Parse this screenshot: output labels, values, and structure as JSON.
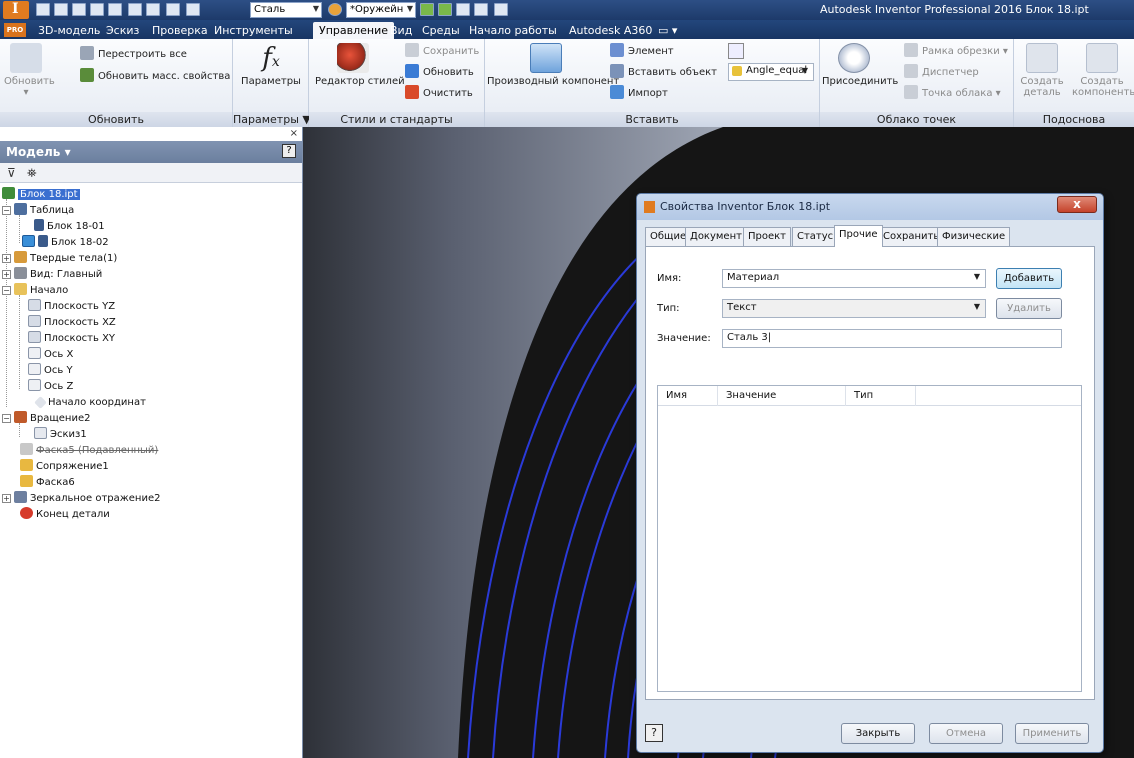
{
  "window": {
    "app_title": "Autodesk Inventor Professional 2016  Блок 18.ipt",
    "qat": {
      "material_combo": "Сталь",
      "appearance_combo": "*Оружейн"
    }
  },
  "ribbon_tabs": [
    "3D-модель",
    "Эскиз",
    "Проверка",
    "Инструменты",
    "Управление",
    "Вид",
    "Среды",
    "Начало работы",
    "Autodesk A360"
  ],
  "active_tab": "Управление",
  "pro_badge": "PRO",
  "ribbon": {
    "update": {
      "title": "Обновить",
      "big_button": "Обновить",
      "rebuild_all": "Перестроить все",
      "update_mass": "Обновить масс. свойства"
    },
    "parameters": {
      "title": "Параметры ▼",
      "button": "Параметры"
    },
    "styles": {
      "title": "Стили и стандарты",
      "editor": "Редактор стилей",
      "save": "Сохранить",
      "update": "Обновить",
      "clear": "Очистить"
    },
    "insert": {
      "title": "Вставить",
      "derived": "Производный компонент",
      "element": "Элемент",
      "insert_object": "Вставить объект",
      "import": "Импорт",
      "ifeature_combo": "Angle_equal"
    },
    "point_cloud": {
      "title": "Облако точек",
      "attach": "Присоединить",
      "crop_frame": "Рамка обрезки",
      "manager": "Диспетчер",
      "cloud_point": "Точка облака"
    },
    "substitute": {
      "title": "Подоснова",
      "create_part_l1": "Создать",
      "create_part_l2": "деталь",
      "create_comp_l1": "Создать",
      "create_comp_l2": "компоненты"
    }
  },
  "browser": {
    "title": "Модель ▾",
    "help": "?",
    "close": "×",
    "tree": [
      {
        "label": "Блок 18.ipt"
      },
      {
        "label": "Таблица"
      },
      {
        "label": "Блок 18-01"
      },
      {
        "label": "Блок 18-02"
      },
      {
        "label": "Твердые тела(1)"
      },
      {
        "label": "Вид: Главный"
      },
      {
        "label": "Начало"
      },
      {
        "label": "Плоскость YZ"
      },
      {
        "label": "Плоскость XZ"
      },
      {
        "label": "Плоскость XY"
      },
      {
        "label": "Ось X"
      },
      {
        "label": "Ось Y"
      },
      {
        "label": "Ось Z"
      },
      {
        "label": "Начало координат"
      },
      {
        "label": "Вращение2"
      },
      {
        "label": "Эскиз1"
      },
      {
        "label": "Фаска5 (Подавленный)"
      },
      {
        "label": "Сопряжение1"
      },
      {
        "label": "Фаска6"
      },
      {
        "label": "Зеркальное отражение2"
      },
      {
        "label": "Конец детали"
      }
    ]
  },
  "dialog": {
    "title": "Свойства Inventor Блок 18.ipt",
    "close": "x",
    "tabs": [
      "Общие",
      "Документ",
      "Проект",
      "Статус",
      "Прочие",
      "Сохранить",
      "Физические"
    ],
    "active_tab": "Прочие",
    "name_label": "Имя:",
    "name_value": "Материал",
    "type_label": "Тип:",
    "type_value": "Текст",
    "value_label": "Значение:",
    "value_value": "Сталь 3",
    "add_button": "Добавить",
    "delete_button": "Удалить",
    "table_headers": [
      "Имя",
      "Значение",
      "Тип"
    ],
    "help": "?",
    "close_button": "Закрыть",
    "cancel_button": "Отмена",
    "apply_button": "Применить"
  }
}
